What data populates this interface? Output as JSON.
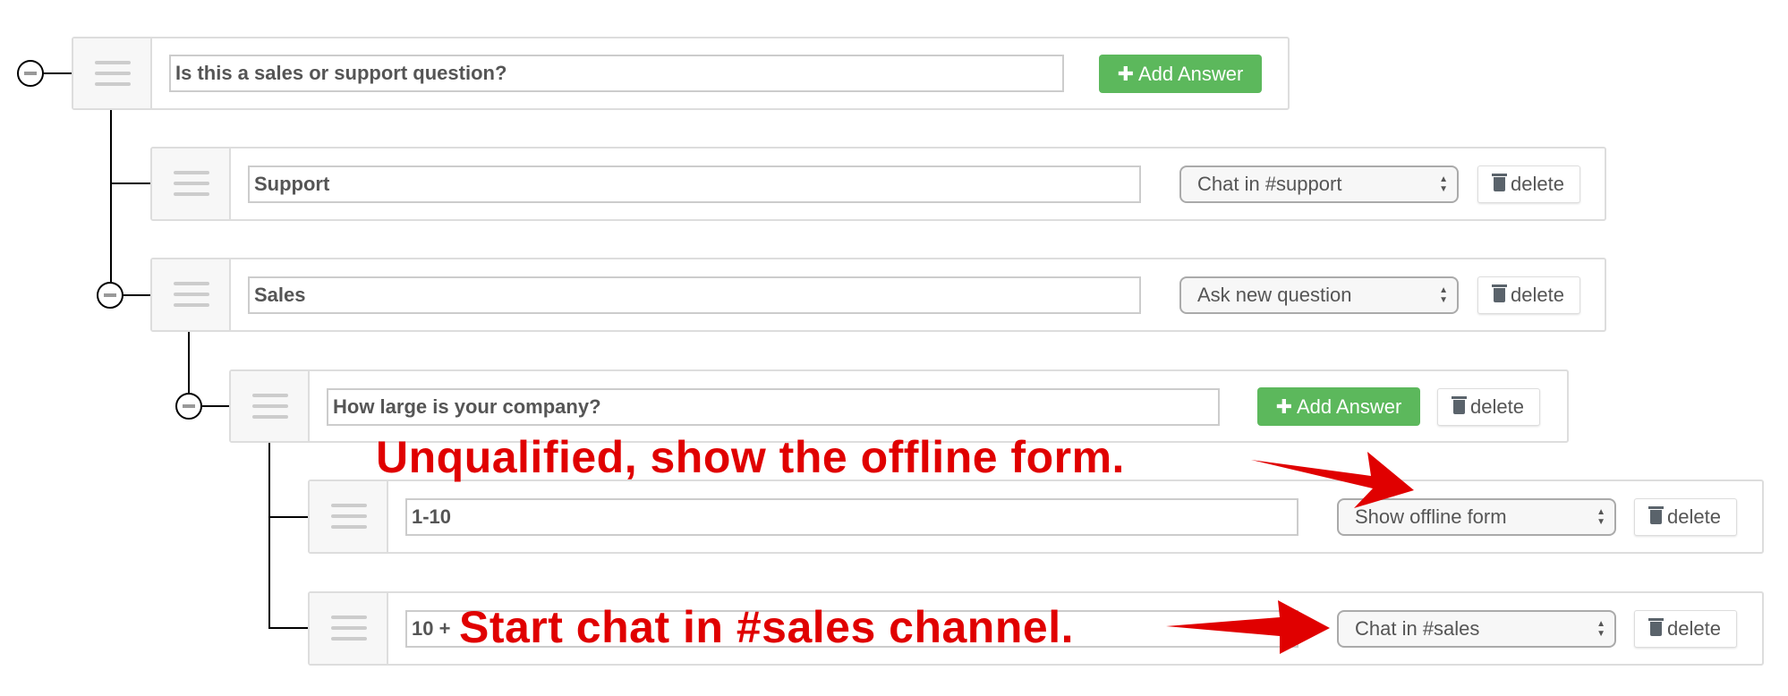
{
  "tree": {
    "question_1": {
      "text": "Is this a sales or support question?",
      "add_answer_label": "Add Answer"
    },
    "answer_support": {
      "text": "Support",
      "action": "Chat in #support",
      "delete_label": "delete"
    },
    "answer_sales": {
      "text": "Sales",
      "action": "Ask new question",
      "delete_label": "delete"
    },
    "question_2": {
      "text": "How large is your company?",
      "add_answer_label": "Add Answer",
      "delete_label": "delete"
    },
    "answer_small": {
      "text": "1-10",
      "action": "Show offline form",
      "delete_label": "delete"
    },
    "answer_large": {
      "text": "10 +",
      "action": "Chat in #sales",
      "delete_label": "delete"
    }
  },
  "annotations": {
    "unqualified": "Unqualified, show the offline form.",
    "start_chat": "Start chat in #sales channel."
  },
  "colors": {
    "accent_green": "#5cb85c",
    "annotation_red": "#e00000"
  }
}
